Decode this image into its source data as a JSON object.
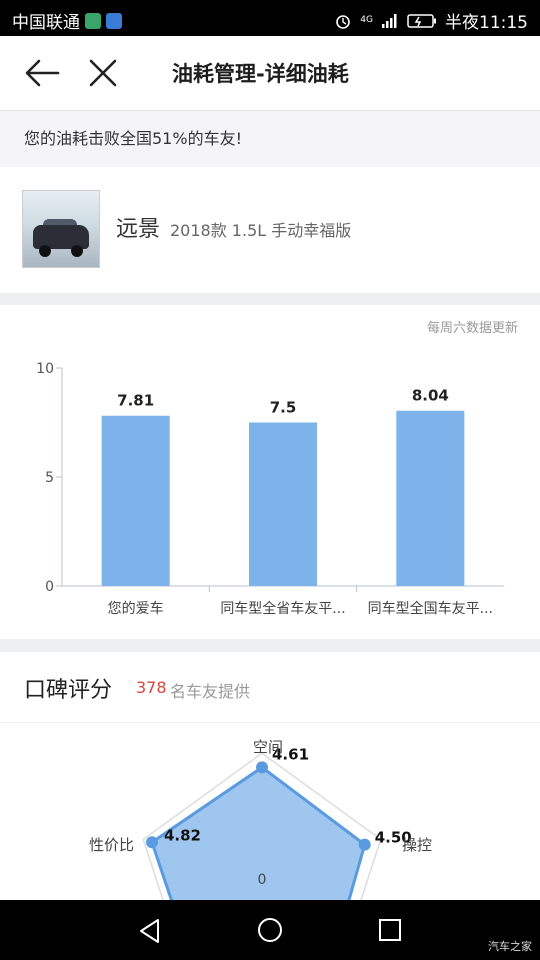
{
  "status_bar": {
    "carrier": "中国联通",
    "network": "4G",
    "time_period": "半夜",
    "time": "11:15"
  },
  "nav": {
    "title": "油耗管理-详细油耗"
  },
  "banner": {
    "text": "您的油耗击败全国51%的车友!"
  },
  "car": {
    "name": "远景",
    "model": "2018款 1.5L 手动幸福版"
  },
  "fuel_chart": {
    "update_note": "每周六数据更新"
  },
  "chart_data": [
    {
      "type": "bar",
      "categories": [
        "您的爱车",
        "同车型全省车友平...",
        "同车型全国车友平..."
      ],
      "values": [
        7.81,
        7.5,
        8.04
      ],
      "data_labels": [
        "7.81",
        "7.5",
        "8.04"
      ],
      "ylim": [
        0,
        10
      ],
      "yticks": [
        0,
        5,
        10
      ],
      "color": "#7db3ea",
      "grid": false
    },
    {
      "type": "radar",
      "axes": [
        "空间",
        "操控",
        "性价比"
      ],
      "values": [
        4.61,
        4.5,
        4.82
      ],
      "data_labels": [
        "4.61",
        "4.50",
        "4.82"
      ],
      "center_label": "0",
      "fill_color": "#7db3ea",
      "line_color": "#5a9be0"
    }
  ],
  "reviews": {
    "title": "口碑评分",
    "count": "378",
    "count_suffix": "名车友提供"
  },
  "watermark": "汽车之家"
}
